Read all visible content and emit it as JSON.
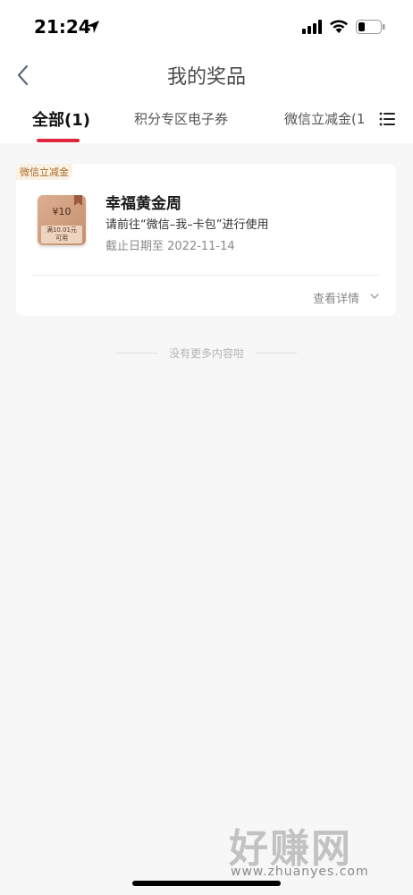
{
  "status_bar": {
    "time": "21:24"
  },
  "header": {
    "title": "我的奖品"
  },
  "tabs": [
    {
      "label": "全部(1)",
      "active": true
    },
    {
      "label": "积分专区电子券",
      "active": false
    },
    {
      "label": "微信立减金(1",
      "active": false
    }
  ],
  "prize": {
    "tag": "微信立减金",
    "coupon_value": "¥10",
    "coupon_condition_line1": "满10.01元",
    "coupon_condition_line2": "可用",
    "name": "幸福黄金周",
    "description": "请前往“微信–我–卡包”进行使用",
    "expiry": "截止日期至  2022-11-14",
    "detail_label": "查看详情"
  },
  "list_end_text": "没有更多内容啦",
  "watermark": {
    "cn": "好赚网",
    "url": "www.zhuanyes.com"
  },
  "colors": {
    "accent": "#e0263c",
    "coupon_tag_bg": "#fbf1e2",
    "coupon_tag_text": "#a86a2b",
    "background": "#f7f7f8"
  }
}
